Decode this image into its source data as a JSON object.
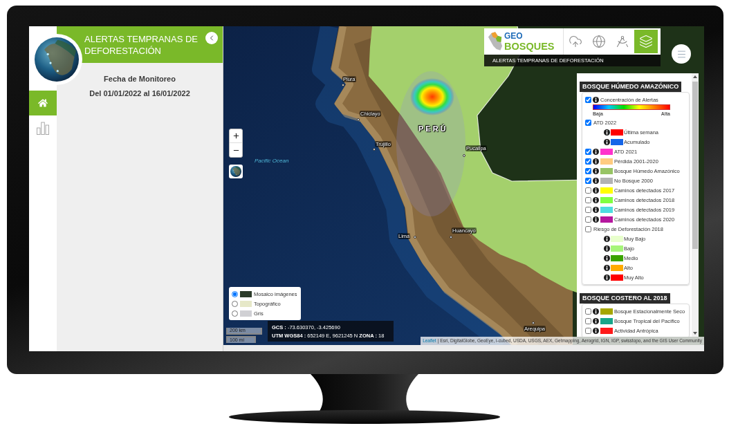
{
  "sidebar": {
    "nav": [
      {
        "kind": "home",
        "selected": true
      },
      {
        "kind": "chart",
        "selected": false
      }
    ]
  },
  "panel": {
    "title": "ALERTAS TEMPRANAS DE DEFORESTACIÓN",
    "heading": "Fecha de Monitoreo",
    "date_range": "Del 01/01/2022 al 16/01/2022"
  },
  "map": {
    "header": {
      "logo": {
        "line_1": "GEO",
        "line_2": "BOSQUES"
      },
      "tools": [
        {
          "kind": "upload",
          "selected": false
        },
        {
          "kind": "globe",
          "selected": false
        },
        {
          "kind": "compass",
          "selected": false
        },
        {
          "kind": "layers",
          "selected": true
        }
      ],
      "subtitle": "ALERTAS TEMPRANAS DE DEFORESTACIÓN"
    },
    "labels": [
      {
        "kind": "city",
        "text": "Piura"
      },
      {
        "kind": "city",
        "text": "Chiclayo"
      },
      {
        "kind": "city",
        "text": "Trujillo"
      },
      {
        "kind": "country",
        "text": "PERÚ"
      },
      {
        "kind": "city",
        "text": "Pucallpa"
      },
      {
        "kind": "ocean",
        "text": "Pacific Ocean"
      },
      {
        "kind": "city",
        "text": "Lima"
      },
      {
        "kind": "city",
        "text": "Huancayo"
      },
      {
        "kind": "city",
        "text": "Arequipa"
      }
    ],
    "legend": {
      "sections": [
        {
          "title": "BOSQUE HÚMEDO AMAZÓNICO",
          "items": [
            {
              "kind": "ramp",
              "label": "Concentración de Alertas",
              "checked": true,
              "low": "Baja",
              "high": "Alta"
            },
            {
              "kind": "group",
              "label": "ATD 2022",
              "checked": true,
              "children": [
                {
                  "label": "Última semana",
                  "color": "#ff0000"
                },
                {
                  "label": "Acumulado",
                  "color": "#1565e8"
                }
              ]
            },
            {
              "kind": "layer",
              "label": "ATD 2021",
              "checked": true,
              "color": "#ff33cc"
            },
            {
              "kind": "layer",
              "label": "Pérdida 2001-2020",
              "checked": true,
              "color": "#ffcc80"
            },
            {
              "kind": "layer",
              "label": "Bosque Húmedo Amazónico",
              "checked": true,
              "color": "#98c464"
            },
            {
              "kind": "layer",
              "label": "No Bosque 2000",
              "checked": true,
              "color": "#b3b3b3"
            },
            {
              "kind": "layer",
              "label": "Caminos detectados 2017",
              "checked": false,
              "color": "#ffff00"
            },
            {
              "kind": "layer",
              "label": "Caminos detectados 2018",
              "checked": false,
              "color": "#80ff40"
            },
            {
              "kind": "layer",
              "label": "Caminos detectados 2019",
              "checked": false,
              "color": "#4ddde0"
            },
            {
              "kind": "layer",
              "label": "Caminos detectados 2020",
              "checked": false,
              "color": "#b5179e"
            },
            {
              "kind": "group",
              "label": "Riesgo de Deforestación 2018",
              "checked": false,
              "children": [
                {
                  "label": "Muy Bajo",
                  "color": "#e8ffcc"
                },
                {
                  "label": "Bajo",
                  "color": "#a6f57a"
                },
                {
                  "label": "Medio",
                  "color": "#3aa300"
                },
                {
                  "label": "Alto",
                  "color": "#ffaa00"
                },
                {
                  "label": "Muy Alto",
                  "color": "#ff0000"
                }
              ]
            }
          ]
        },
        {
          "title": "BOSQUE COSTERO AL 2018",
          "items": [
            {
              "kind": "layer",
              "label": "Bosque Estacionalmente Seco",
              "checked": false,
              "color": "#a6a600"
            },
            {
              "kind": "layer",
              "label": "Bosque Tropical del Pacífico",
              "checked": false,
              "color": "#17a68a"
            },
            {
              "kind": "layer",
              "label": "Actividad Antrópica",
              "checked": false,
              "color": "#ff1a1a"
            }
          ]
        }
      ]
    },
    "basemaps": [
      {
        "label": "Mosaico imágenes",
        "selected": true,
        "color": "#2c3b2a"
      },
      {
        "label": "Topográfico",
        "selected": false,
        "color": "#e6e8c8"
      },
      {
        "label": "Gris",
        "selected": false,
        "color": "#d0d0d4"
      }
    ],
    "scale": {
      "metric": "200 km",
      "imperial": "100 mi"
    },
    "coordinates": {
      "gcs": "**GCS :** -73.630370, -3.425690",
      "utm": "**UTM WGS84 :** 652149 E, 9621245 N **ZONA :** 18"
    },
    "attribution": {
      "link": "Leaflet",
      "text": "| Esri, DigitalGlobe, GeoEye, i-cubed, USDA, USGS, AEX, Getmapping, Aerogrid, IGN, IGP, swisstopo, and the GIS User Community"
    }
  }
}
